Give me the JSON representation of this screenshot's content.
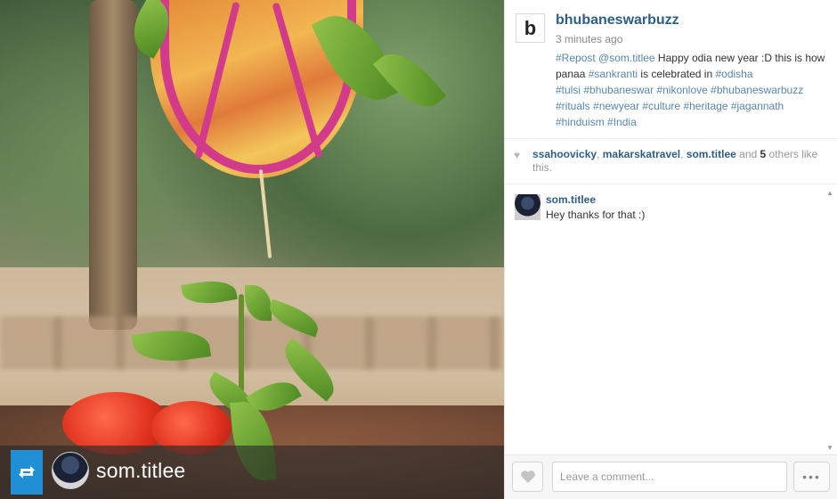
{
  "post": {
    "owner": "bhubaneswarbuzz",
    "owner_avatar_glyph": "b",
    "time": "3 minutes ago",
    "caption": {
      "repost_tag": "#Repost",
      "repost_user": "@som.titlee",
      "text_1": " Happy odia new year :D this is how panaa ",
      "tag_sankranti": "#sankranti",
      "text_2": " is celebrated in ",
      "tag_odisha": "#odisha",
      "tags_line": [
        "#tulsi",
        "#bhubaneswar",
        "#nikonlove",
        "#bhubaneswarbuzz",
        "#rituals",
        "#newyear",
        "#culture",
        "#heritage",
        "#jagannath",
        "#hinduism",
        "#India"
      ]
    }
  },
  "likes": {
    "users": [
      "ssahoovicky",
      "makarskatravel",
      "som.titlee"
    ],
    "sep1": ", ",
    "sep2": ", ",
    "and": " and ",
    "others_count": "5",
    "others_text": " others like this."
  },
  "comments": [
    {
      "user": "som.titlee",
      "text": "Hey thanks for that :)"
    }
  ],
  "photo": {
    "repost_user": "som.titlee"
  },
  "footer": {
    "comment_placeholder": "Leave a comment...",
    "more_label": "•••"
  },
  "colors": {
    "link": "#2e5e86",
    "hashtag": "#5a86ad",
    "repost_blue": "#1f8fd6"
  },
  "icons": [
    "repost-icon",
    "heart-icon",
    "scroll-up-icon",
    "scroll-down-icon"
  ]
}
